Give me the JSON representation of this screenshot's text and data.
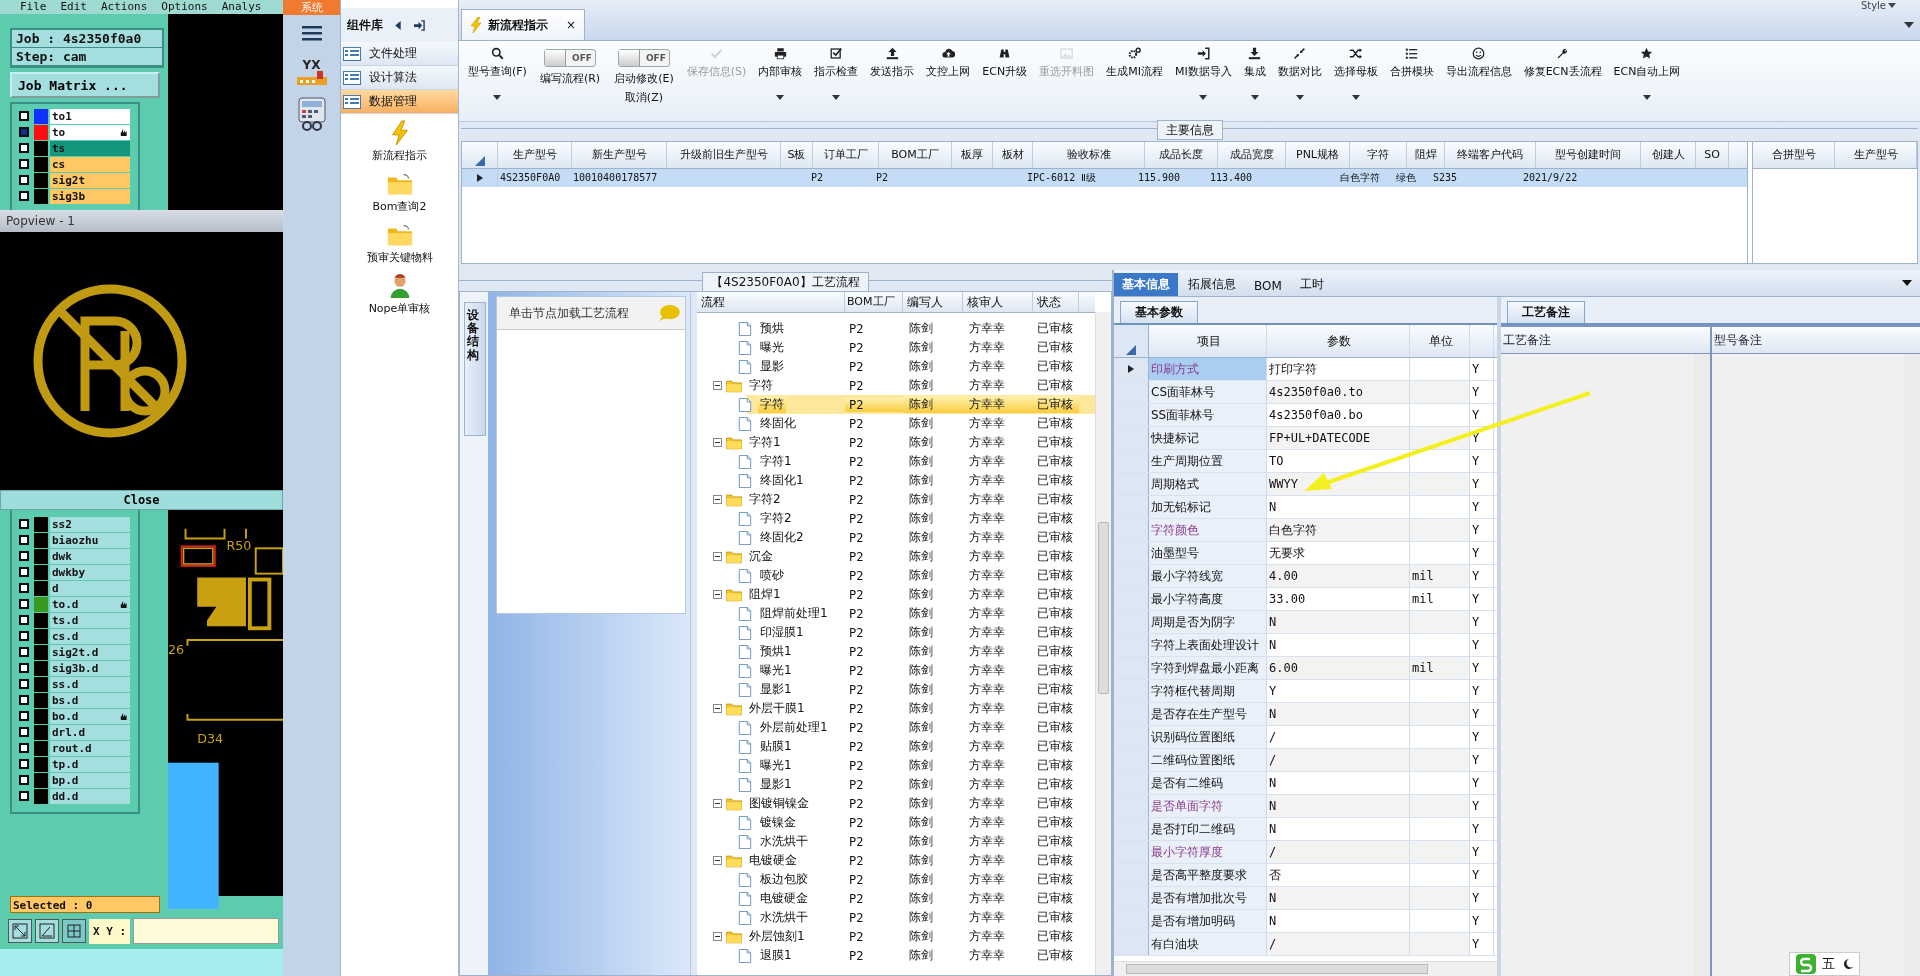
{
  "cam": {
    "menu": [
      "File",
      "Edit",
      "Actions",
      "Options",
      "Analys"
    ],
    "job": "Job : 4s2350f0a0",
    "step": "Step: cam",
    "matrix_button": "Job Matrix ...",
    "layers_above": [
      {
        "name": "to1",
        "kind": "plain",
        "color": "#1030ff",
        "locked": false,
        "checked": false
      },
      {
        "name": "to",
        "kind": "plain",
        "color": "#ff1010",
        "locked": true,
        "checked": true
      },
      {
        "name": "ts",
        "kind": "mask",
        "locked": false,
        "checked": false
      },
      {
        "name": "cs",
        "kind": "signal",
        "locked": false,
        "checked": false
      },
      {
        "name": "sig2t",
        "kind": "signal",
        "locked": false,
        "checked": false
      },
      {
        "name": "sig3b",
        "kind": "signal",
        "locked": false,
        "checked": false
      }
    ],
    "layers_below": [
      {
        "name": "ss2",
        "kind": "doc",
        "locked": false,
        "checked": false
      },
      {
        "name": "biaozhu",
        "kind": "doc",
        "locked": false,
        "checked": false
      },
      {
        "name": "dwk",
        "kind": "doc",
        "locked": false,
        "checked": false
      },
      {
        "name": "dwkby",
        "kind": "doc",
        "locked": false,
        "checked": false
      },
      {
        "name": "d",
        "kind": "doc",
        "locked": false,
        "checked": false
      },
      {
        "name": "to.d",
        "kind": "doc",
        "color": "#3a9a20",
        "locked": true,
        "checked": false
      },
      {
        "name": "ts.d",
        "kind": "doc",
        "locked": false,
        "checked": false
      },
      {
        "name": "cs.d",
        "kind": "doc",
        "locked": false,
        "checked": false
      },
      {
        "name": "sig2t.d",
        "kind": "doc",
        "locked": false,
        "checked": false
      },
      {
        "name": "sig3b.d",
        "kind": "doc",
        "locked": false,
        "checked": false
      },
      {
        "name": "ss.d",
        "kind": "doc",
        "locked": false,
        "checked": false
      },
      {
        "name": "bs.d",
        "kind": "doc",
        "locked": false,
        "checked": false
      },
      {
        "name": "bo.d",
        "kind": "doc",
        "locked": true,
        "checked": false
      },
      {
        "name": "drl.d",
        "kind": "doc",
        "locked": false,
        "checked": false
      },
      {
        "name": "rout.d",
        "kind": "doc",
        "locked": false,
        "checked": false
      },
      {
        "name": "tp.d",
        "kind": "doc",
        "locked": false,
        "checked": false
      },
      {
        "name": "bp.d",
        "kind": "doc",
        "locked": false,
        "checked": false
      },
      {
        "name": "dd.d",
        "kind": "doc",
        "locked": false,
        "checked": false
      }
    ],
    "canvas_labels": [
      "R50",
      "26",
      "D34"
    ],
    "popview": {
      "title": "Popview - 1",
      "close": "Close"
    },
    "selected_count": "Selected : 0",
    "xy_label": "X Y :"
  },
  "app": {
    "system_label": "系统",
    "logo_text": "YX",
    "style_label": "Style",
    "library": {
      "title": "组件库",
      "sections": [
        {
          "label": "文件处理",
          "selected": false
        },
        {
          "label": "设计算法",
          "selected": false
        },
        {
          "label": "数据管理",
          "selected": true
        }
      ],
      "apps": [
        "新流程指示",
        "Bom查询2",
        "预审关键物料",
        "Nope单审核"
      ]
    },
    "tab": {
      "label": "新流程指示",
      "close": "×"
    },
    "toolbar": [
      {
        "kind": "button",
        "label": "型号查询(F)",
        "caret": true,
        "disabled": false
      },
      {
        "kind": "toggle",
        "switch": "OFF",
        "on": false,
        "labels": [
          "编写流程(R)"
        ]
      },
      {
        "kind": "toggle",
        "switch": "OFF",
        "on": false,
        "labels": [
          "启动修改(E)",
          "取消(Z)"
        ]
      },
      {
        "kind": "button",
        "label": "保存信息(S)",
        "caret": false,
        "disabled": true
      },
      {
        "kind": "button",
        "label": "内部审核",
        "caret": true,
        "disabled": false
      },
      {
        "kind": "button",
        "label": "指示检查",
        "caret": true,
        "disabled": false
      },
      {
        "kind": "button",
        "label": "发送指示",
        "caret": false,
        "disabled": false
      },
      {
        "kind": "button",
        "label": "文控上网",
        "caret": false,
        "disabled": false
      },
      {
        "kind": "button",
        "label": "ECN升级",
        "caret": false,
        "disabled": false
      },
      {
        "kind": "button",
        "label": "重选开料图",
        "caret": false,
        "disabled": true
      },
      {
        "kind": "button",
        "label": "生成MI流程",
        "caret": false,
        "disabled": false
      },
      {
        "kind": "button",
        "label": "MI数据导入",
        "caret": true,
        "disabled": false
      },
      {
        "kind": "button",
        "label": "集成",
        "caret": true,
        "disabled": false
      },
      {
        "kind": "button",
        "label": "数据对比",
        "caret": true,
        "disabled": false
      },
      {
        "kind": "button",
        "label": "选择母板",
        "caret": true,
        "disabled": false
      },
      {
        "kind": "button",
        "label": "合拼模块",
        "caret": false,
        "disabled": false
      },
      {
        "kind": "button",
        "label": "导出流程信息",
        "caret": false,
        "disabled": false
      },
      {
        "kind": "button",
        "label": "修复ECN丢流程",
        "caret": false,
        "disabled": false
      },
      {
        "kind": "button",
        "label": "ECN自动上网",
        "caret": true,
        "disabled": false
      }
    ],
    "main_info": {
      "title": "主要信息",
      "columns": [
        "生产型号",
        "新生产型号",
        "升级前旧生产型号",
        "S板",
        "订单工厂",
        "BOM工厂",
        "板厚",
        "板材",
        "验收标准",
        "成品长度",
        "成品宽度",
        "PNL规格",
        "字符",
        "阻焊",
        "终端客户代码",
        "型号创建时间",
        "创建人",
        "SO"
      ],
      "rows": [
        {
          "selected": true,
          "cells": [
            "4S2350F0A0",
            "10010400178577",
            null,
            null,
            "P2",
            "P2",
            null,
            null,
            "IPC-6012 Ⅱ级",
            "115.900",
            "113.400",
            null,
            "白色字符",
            "绿色",
            "S235",
            "2021/9/22",
            null,
            null
          ]
        }
      ],
      "merge_columns": [
        "合拼型号",
        "生产型号"
      ]
    },
    "flow": {
      "title": "【4S2350F0A0】工艺流程",
      "side_tab": "设备结构",
      "hint": "单击节点加载工艺流程",
      "columns": [
        "流程",
        "BOM工厂",
        "编写人",
        "核审人",
        "状态"
      ],
      "rows": [
        {
          "name": "预烘",
          "kind": "step",
          "bom": "P2",
          "writer": "陈剑",
          "reviewer": "方幸幸",
          "status": "已审核",
          "selected": false
        },
        {
          "name": "曝光",
          "kind": "step",
          "bom": "P2",
          "writer": "陈剑",
          "reviewer": "方幸幸",
          "status": "已审核",
          "selected": false
        },
        {
          "name": "显影",
          "kind": "step",
          "bom": "P2",
          "writer": "陈剑",
          "reviewer": "方幸幸",
          "status": "已审核",
          "selected": false
        },
        {
          "name": "字符",
          "kind": "group",
          "bom": "P2",
          "writer": "陈剑",
          "reviewer": "方幸幸",
          "status": "已审核",
          "selected": false,
          "children": [
            {
              "name": "字符",
              "kind": "step",
              "bom": "P2",
              "writer": "陈剑",
              "reviewer": "方幸幸",
              "status": "已审核",
              "selected": true
            },
            {
              "name": "终固化",
              "kind": "step",
              "bom": "P2",
              "writer": "陈剑",
              "reviewer": "方幸幸",
              "status": "已审核",
              "selected": false
            }
          ]
        },
        {
          "name": "字符1",
          "kind": "group",
          "bom": "P2",
          "writer": "陈剑",
          "reviewer": "方幸幸",
          "status": "已审核",
          "selected": false,
          "children": [
            {
              "name": "字符1",
              "kind": "step",
              "bom": "P2",
              "writer": "陈剑",
              "reviewer": "方幸幸",
              "status": "已审核",
              "selected": false
            },
            {
              "name": "终固化1",
              "kind": "step",
              "bom": "P2",
              "writer": "陈剑",
              "reviewer": "方幸幸",
              "status": "已审核",
              "selected": false
            }
          ]
        },
        {
          "name": "字符2",
          "kind": "group",
          "bom": "P2",
          "writer": "陈剑",
          "reviewer": "方幸幸",
          "status": "已审核",
          "selected": false,
          "children": [
            {
              "name": "字符2",
              "kind": "step",
              "bom": "P2",
              "writer": "陈剑",
              "reviewer": "方幸幸",
              "status": "已审核",
              "selected": false
            },
            {
              "name": "终固化2",
              "kind": "step",
              "bom": "P2",
              "writer": "陈剑",
              "reviewer": "方幸幸",
              "status": "已审核",
              "selected": false
            }
          ]
        },
        {
          "name": "沉金",
          "kind": "group",
          "bom": "P2",
          "writer": "陈剑",
          "reviewer": "方幸幸",
          "status": "已审核",
          "selected": false,
          "children": [
            {
              "name": "喷砂",
              "kind": "step",
              "bom": "P2",
              "writer": "陈剑",
              "reviewer": "方幸幸",
              "status": "已审核",
              "selected": false
            }
          ]
        },
        {
          "name": "阻焊1",
          "kind": "group",
          "bom": "P2",
          "writer": "陈剑",
          "reviewer": "方幸幸",
          "status": "已审核",
          "selected": false,
          "children": [
            {
              "name": "阻焊前处理1",
              "kind": "step",
              "bom": "P2",
              "writer": "陈剑",
              "reviewer": "方幸幸",
              "status": "已审核",
              "selected": false
            },
            {
              "name": "印湿膜1",
              "kind": "step",
              "bom": "P2",
              "writer": "陈剑",
              "reviewer": "方幸幸",
              "status": "已审核",
              "selected": false
            },
            {
              "name": "预烘1",
              "kind": "step",
              "bom": "P2",
              "writer": "陈剑",
              "reviewer": "方幸幸",
              "status": "已审核",
              "selected": false
            },
            {
              "name": "曝光1",
              "kind": "step",
              "bom": "P2",
              "writer": "陈剑",
              "reviewer": "方幸幸",
              "status": "已审核",
              "selected": false
            },
            {
              "name": "显影1",
              "kind": "step",
              "bom": "P2",
              "writer": "陈剑",
              "reviewer": "方幸幸",
              "status": "已审核",
              "selected": false
            }
          ]
        },
        {
          "name": "外层干膜1",
          "kind": "group",
          "bom": "P2",
          "writer": "陈剑",
          "reviewer": "方幸幸",
          "status": "已审核",
          "selected": false,
          "children": [
            {
              "name": "外层前处理1",
              "kind": "step",
              "bom": "P2",
              "writer": "陈剑",
              "reviewer": "方幸幸",
              "status": "已审核",
              "selected": false
            },
            {
              "name": "贴膜1",
              "kind": "step",
              "bom": "P2",
              "writer": "陈剑",
              "reviewer": "方幸幸",
              "status": "已审核",
              "selected": false
            },
            {
              "name": "曝光1",
              "kind": "step",
              "bom": "P2",
              "writer": "陈剑",
              "reviewer": "方幸幸",
              "status": "已审核",
              "selected": false
            },
            {
              "name": "显影1",
              "kind": "step",
              "bom": "P2",
              "writer": "陈剑",
              "reviewer": "方幸幸",
              "status": "已审核",
              "selected": false
            }
          ]
        },
        {
          "name": "图镀铜镍金",
          "kind": "group",
          "bom": "P2",
          "writer": "陈剑",
          "reviewer": "方幸幸",
          "status": "已审核",
          "selected": false,
          "children": [
            {
              "name": "镀镍金",
              "kind": "step",
              "bom": "P2",
              "writer": "陈剑",
              "reviewer": "方幸幸",
              "status": "已审核",
              "selected": false
            },
            {
              "name": "水洗烘干",
              "kind": "step",
              "bom": "P2",
              "writer": "陈剑",
              "reviewer": "方幸幸",
              "status": "已审核",
              "selected": false
            }
          ]
        },
        {
          "name": "电镀硬金",
          "kind": "group",
          "bom": "P2",
          "writer": "陈剑",
          "reviewer": "方幸幸",
          "status": "已审核",
          "selected": false,
          "children": [
            {
              "name": "板边包胶",
              "kind": "step",
              "bom": "P2",
              "writer": "陈剑",
              "reviewer": "方幸幸",
              "status": "已审核",
              "selected": false
            },
            {
              "name": "电镀硬金",
              "kind": "step",
              "bom": "P2",
              "writer": "陈剑",
              "reviewer": "方幸幸",
              "status": "已审核",
              "selected": false
            },
            {
              "name": "水洗烘干",
              "kind": "step",
              "bom": "P2",
              "writer": "陈剑",
              "reviewer": "方幸幸",
              "status": "已审核",
              "selected": false
            }
          ]
        },
        {
          "name": "外层蚀刻1",
          "kind": "group",
          "bom": "P2",
          "writer": "陈剑",
          "reviewer": "方幸幸",
          "status": "已审核",
          "selected": false,
          "children": [
            {
              "name": "退膜1",
              "kind": "step",
              "bom": "P2",
              "writer": "陈剑",
              "reviewer": "方幸幸",
              "status": "已审核",
              "selected": false
            }
          ]
        }
      ]
    },
    "detail": {
      "tabs": [
        {
          "label": "基本信息",
          "selected": true
        },
        {
          "label": "拓展信息",
          "selected": false
        },
        {
          "label": "BOM",
          "selected": false
        },
        {
          "label": "工时",
          "selected": false
        }
      ],
      "subtab": "基本参数",
      "columns": [
        "项目",
        "参数",
        "单位"
      ],
      "rows": [
        {
          "item": "印刷方式",
          "value": "打印字符",
          "check": "Y",
          "flagged": true,
          "selected": true
        },
        {
          "item": "CS面菲林号",
          "value": "4s2350f0a0.to",
          "check": "Y",
          "flagged": false,
          "selected": false
        },
        {
          "item": "SS面菲林号",
          "value": "4s2350f0a0.bo",
          "check": "Y",
          "flagged": false,
          "selected": false
        },
        {
          "item": "快捷标记",
          "value": "FP+UL+DATECODE",
          "check": "Y",
          "flagged": false,
          "selected": false
        },
        {
          "item": "生产周期位置",
          "value": "TO",
          "check": "Y",
          "flagged": false,
          "selected": false
        },
        {
          "item": "周期格式",
          "value": "WWYY",
          "check": "Y",
          "flagged": false,
          "selected": false
        },
        {
          "item": "加无铅标记",
          "value": "N",
          "check": "Y",
          "flagged": false,
          "selected": false
        },
        {
          "item": "字符颜色",
          "value": "白色字符",
          "check": "Y",
          "flagged": true,
          "selected": false
        },
        {
          "item": "油墨型号",
          "value": "无要求",
          "check": "Y",
          "flagged": false,
          "selected": false
        },
        {
          "item": "最小字符线宽",
          "value": "4.00",
          "unit": "mil",
          "check": "Y",
          "flagged": false,
          "selected": false
        },
        {
          "item": "最小字符高度",
          "value": "33.00",
          "unit": "mil",
          "check": "Y",
          "flagged": false,
          "selected": false
        },
        {
          "item": "周期是否为阴字",
          "value": "N",
          "check": "Y",
          "flagged": false,
          "selected": false
        },
        {
          "item": "字符上表面处理设计",
          "value": "N",
          "check": "Y",
          "flagged": false,
          "selected": false
        },
        {
          "item": "字符到焊盘最小距离",
          "value": "6.00",
          "unit": "mil",
          "check": "Y",
          "flagged": false,
          "selected": false
        },
        {
          "item": "字符框代替周期",
          "value": "Y",
          "check": "Y",
          "flagged": false,
          "selected": false
        },
        {
          "item": "是否存在生产型号",
          "value": "N",
          "check": "Y",
          "flagged": false,
          "selected": false
        },
        {
          "item": "识别码位置图纸",
          "value": "/",
          "check": "Y",
          "flagged": false,
          "selected": false
        },
        {
          "item": "二维码位置图纸",
          "value": "/",
          "check": "Y",
          "flagged": false,
          "selected": false
        },
        {
          "item": "是否有二维码",
          "value": "N",
          "check": "Y",
          "flagged": false,
          "selected": false
        },
        {
          "item": "是否单面字符",
          "value": "N",
          "check": "Y",
          "flagged": true,
          "selected": false
        },
        {
          "item": "是否打印二维码",
          "value": "N",
          "check": "Y",
          "flagged": false,
          "selected": false
        },
        {
          "item": "最小字符厚度",
          "value": "/",
          "check": "Y",
          "flagged": true,
          "selected": false
        },
        {
          "item": "是否高平整度要求",
          "value": "否",
          "check": "Y",
          "flagged": false,
          "selected": false
        },
        {
          "item": "是否有增加批次号",
          "value": "N",
          "check": "Y",
          "flagged": false,
          "selected": false
        },
        {
          "item": "是否有增加明码",
          "value": "N",
          "check": "Y",
          "flagged": false,
          "selected": false
        },
        {
          "item": "有白油块",
          "value": "/",
          "check": "Y",
          "flagged": false,
          "selected": false
        }
      ]
    },
    "notes": {
      "subtab": "工艺备注",
      "columns": [
        "工艺备注",
        "型号备注"
      ]
    },
    "ime": {
      "label": "五"
    }
  }
}
